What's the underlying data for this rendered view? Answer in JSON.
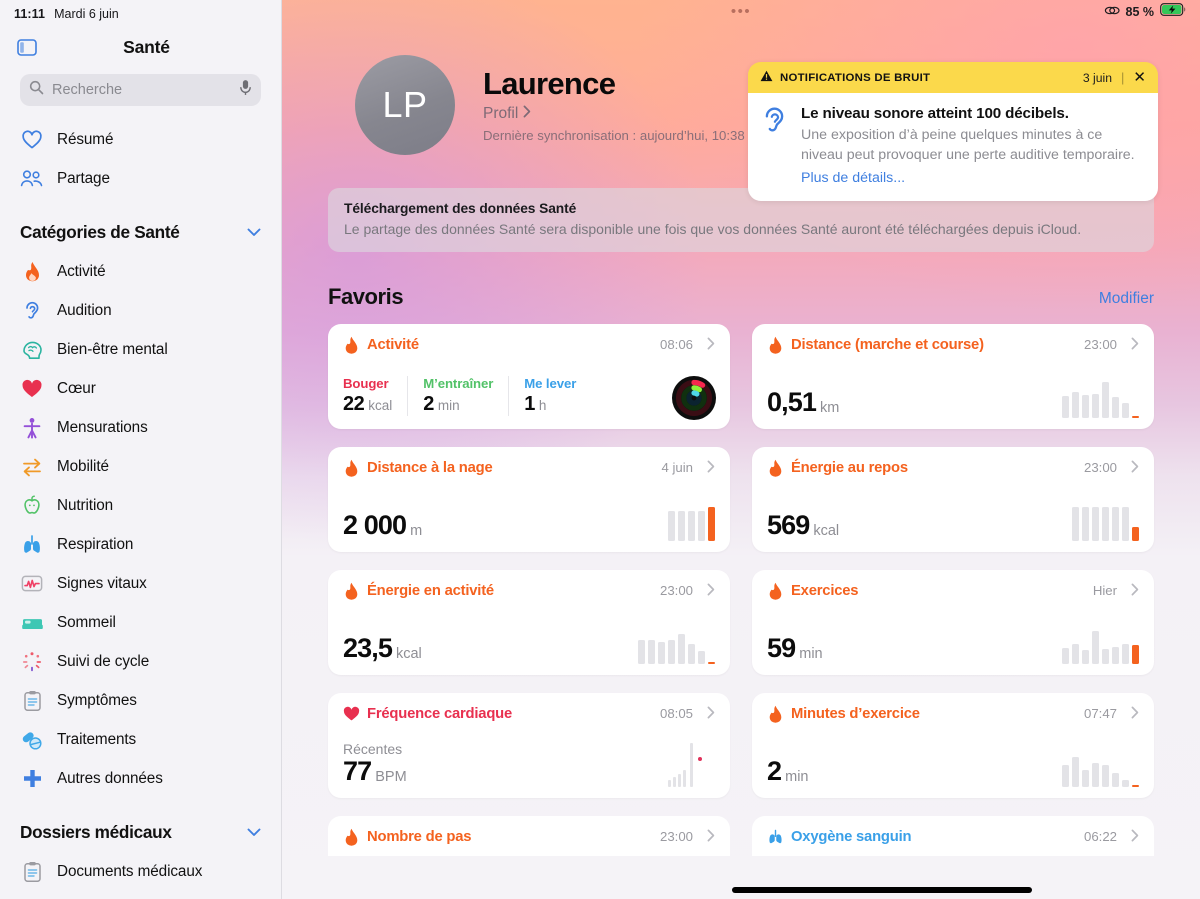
{
  "status_bar": {
    "time": "11:11",
    "date": "Mardi 6 juin",
    "battery_percent": "85 %",
    "multitask_dots": "•••"
  },
  "sidebar": {
    "app_title": "Santé",
    "search_placeholder": "Recherche",
    "top_items": [
      {
        "label": "Résumé",
        "icon": "heart-outline-icon",
        "color": "#3f7fe0"
      },
      {
        "label": "Partage",
        "icon": "people-icon",
        "color": "#3f7fe0"
      }
    ],
    "categories_header": "Catégories de Santé",
    "categories": [
      {
        "label": "Activité",
        "icon": "flame-icon",
        "color": "#f4621f"
      },
      {
        "label": "Audition",
        "icon": "ear-icon",
        "color": "#3f7fe0"
      },
      {
        "label": "Bien-être mental",
        "icon": "brain-head-icon",
        "color": "#2bb4a0"
      },
      {
        "label": "Cœur",
        "icon": "heart-filled-icon",
        "color": "#e8304f"
      },
      {
        "label": "Mensurations",
        "icon": "body-icon",
        "color": "#9450d8"
      },
      {
        "label": "Mobilité",
        "icon": "arrows-icon",
        "color": "#f09a28"
      },
      {
        "label": "Nutrition",
        "icon": "apple-icon",
        "color": "#52c268"
      },
      {
        "label": "Respiration",
        "icon": "lungs-icon",
        "color": "#3aa0e8"
      },
      {
        "label": "Signes vitaux",
        "icon": "vitals-waveform-icon",
        "color": "#ef4066"
      },
      {
        "label": "Sommeil",
        "icon": "bed-icon",
        "color": "#3ec7b4"
      },
      {
        "label": "Suivi de cycle",
        "icon": "cycle-icon",
        "color": "#ee5a6a"
      },
      {
        "label": "Symptômes",
        "icon": "clipboard-icon",
        "color": "#9b9ba1"
      },
      {
        "label": "Traitements",
        "icon": "pills-icon",
        "color": "#3fa8e8"
      },
      {
        "label": "Autres données",
        "icon": "plus-cross-icon",
        "color": "#3f7fe0"
      }
    ],
    "records_header": "Dossiers médicaux",
    "records": [
      {
        "label": "Documents médicaux",
        "icon": "clipboard-icon",
        "color": "#9b9ba1"
      }
    ]
  },
  "profile": {
    "initials": "LP",
    "name": "Laurence",
    "profile_link": "Profil",
    "last_sync": "Dernière synchronisation : aujourd’hui, 10:38"
  },
  "notification": {
    "header_title": "NOTIFICATIONS DE BRUIT",
    "date": "3 juin",
    "close": "✕",
    "icon": "ear-icon",
    "headline": "Le niveau sonore atteint 100 décibels.",
    "body": "Une exposition d’à peine quelques minutes à ce niveau peut provoquer une perte auditive temporaire.",
    "link": "Plus de détails..."
  },
  "download_banner": {
    "title": "Téléchargement des données Santé",
    "description": "Le partage des données Santé sera disponible une fois que vos données Santé auront été téléchargées depuis iCloud."
  },
  "favorites": {
    "title": "Favoris",
    "edit_label": "Modifier"
  },
  "activity_card": {
    "title": "Activité",
    "icon": "flame-icon",
    "time": "08:06",
    "accent": "#f4621f",
    "move": {
      "label": "Bouger",
      "value": "22",
      "unit": "kcal",
      "color": "#e8304f"
    },
    "exercise": {
      "label": "M’entraîner",
      "value": "2",
      "unit": "min",
      "color": "#52c268"
    },
    "stand": {
      "label": "Me lever",
      "value": "1",
      "unit": "h",
      "color": "#3aa0e8"
    }
  },
  "chart_data": [
    {
      "type": "bar",
      "title": "Distance (marche et course)",
      "values": [
        22,
        26,
        23,
        24,
        36,
        21,
        15
      ],
      "highlight_index": 7,
      "highlight_value": 2,
      "ymax": 40
    },
    {
      "type": "bar",
      "title": "Distance à la nage",
      "values": [
        30,
        30,
        30,
        30
      ],
      "highlight_index": 4,
      "highlight_value": 34,
      "ymax": 36
    },
    {
      "type": "bar",
      "title": "Énergie au repos",
      "values": [
        34,
        34,
        34,
        34,
        34,
        34
      ],
      "highlight_index": 6,
      "highlight_value": 14,
      "ymax": 36
    },
    {
      "type": "bar",
      "title": "Énergie en activité",
      "values": [
        24,
        24,
        22,
        24,
        30,
        20,
        13
      ],
      "highlight_index": 7,
      "highlight_value": 2,
      "ymax": 32
    },
    {
      "type": "bar",
      "title": "Exercices",
      "values": [
        16,
        20,
        14,
        33,
        15,
        17,
        20
      ],
      "highlight_index": 7,
      "highlight_value": 19,
      "ymax": 36
    },
    {
      "type": "bar",
      "title": "Fréquence cardiaque",
      "values": [
        5,
        7,
        9,
        12,
        34
      ],
      "highlight_index": null,
      "highlight_value": null,
      "ymax": 38,
      "dot_value": 22
    },
    {
      "type": "bar",
      "title": "Minutes d’exercice",
      "values": [
        22,
        30,
        17,
        24,
        22,
        14,
        7
      ],
      "highlight_index": 7,
      "highlight_value": 2,
      "ymax": 32
    }
  ],
  "cards": [
    {
      "title": "Distance (marche et course)",
      "icon": "flame-icon",
      "accent": "#f4621f",
      "time": "23:00",
      "value": "0,51",
      "unit": "km",
      "bars": [
        22,
        26,
        23,
        24,
        36,
        21,
        15
      ],
      "tail": 2
    },
    {
      "title": "Distance à la nage",
      "icon": "flame-icon",
      "accent": "#f4621f",
      "time": "4 juin",
      "value": "2 000",
      "unit": "m",
      "bars": [
        30,
        30,
        30,
        30
      ],
      "tail": 34
    },
    {
      "title": "Énergie au repos",
      "icon": "flame-icon",
      "accent": "#f4621f",
      "time": "23:00",
      "value": "569",
      "unit": "kcal",
      "bars": [
        34,
        34,
        34,
        34,
        34,
        34
      ],
      "tail": 14
    },
    {
      "title": "Énergie en activité",
      "icon": "flame-icon",
      "accent": "#f4621f",
      "time": "23:00",
      "value": "23,5",
      "unit": "kcal",
      "bars": [
        24,
        24,
        22,
        24,
        30,
        20,
        13
      ],
      "tail": 2
    },
    {
      "title": "Exercices",
      "icon": "flame-icon",
      "accent": "#f4621f",
      "time": "Hier",
      "value": "59",
      "unit": "min",
      "bars": [
        16,
        20,
        14,
        33,
        15,
        17,
        20
      ],
      "tail": 19
    },
    {
      "title": "Fréquence cardiaque",
      "icon": "heart-filled-icon",
      "accent": "#e8304f",
      "time": "08:05",
      "sub": "Récentes",
      "value": "77",
      "unit": "BPM",
      "bars": [
        5,
        7,
        9,
        12,
        34
      ],
      "tail": 0
    },
    {
      "title": "Minutes d’exercice",
      "icon": "flame-icon",
      "accent": "#f4621f",
      "time": "07:47",
      "value": "2",
      "unit": "min",
      "bars": [
        22,
        30,
        17,
        24,
        22,
        14,
        7
      ],
      "tail": 2
    }
  ],
  "bottom_cards": [
    {
      "title": "Nombre de pas",
      "icon": "flame-icon",
      "accent": "#f4621f",
      "time": "23:00"
    },
    {
      "title": "Oxygène sanguin",
      "icon": "lungs-icon",
      "accent": "#3aa0e8",
      "time": "06:22"
    }
  ]
}
